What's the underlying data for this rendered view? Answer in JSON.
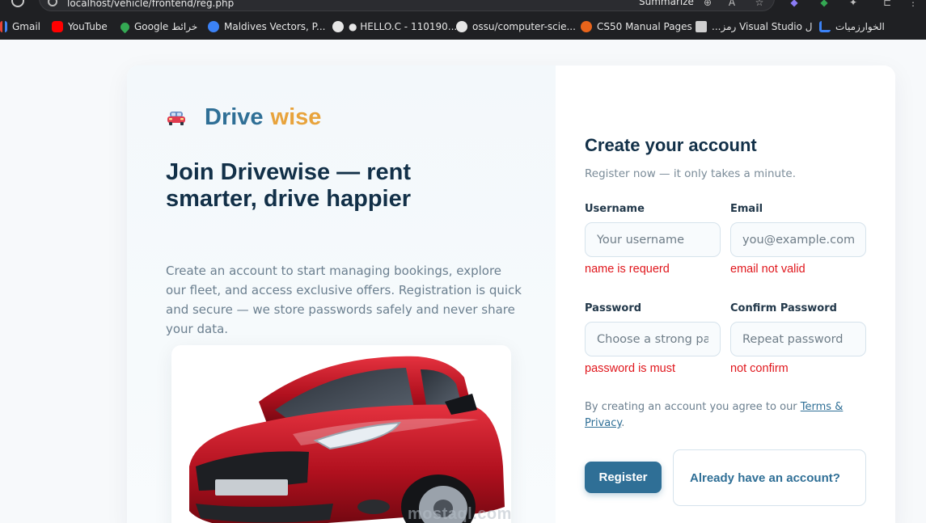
{
  "browser": {
    "url": "localhost/vehicle/frontend/reg.php",
    "summarize_label": "Summarize",
    "bookmarks": [
      {
        "label": "Gmail",
        "color": "#ea4335"
      },
      {
        "label": "YouTube",
        "color": "#ff0000"
      },
      {
        "label": "Google خرائط",
        "color": "#34a853"
      },
      {
        "label": "Maldives Vectors, P...",
        "color": "#3b82f6"
      },
      {
        "label": "● HELLO.C - 110190...",
        "color": "#e6e6e6"
      },
      {
        "label": "ossu/computer-scie...",
        "color": "#e6e6e6"
      },
      {
        "label": "CS50 Manual Pages",
        "color": "#e8641b"
      },
      {
        "label": "...رمز Visual Studio ل",
        "color": "#cfcfcf"
      },
      {
        "label": "الخوارزميات",
        "color": "#3b82f6"
      }
    ]
  },
  "brand": {
    "part1": "Drive",
    "part2": "wise"
  },
  "left": {
    "headline": "Join Drivewise — rent smarter, drive happier",
    "intro": "Create an account to start managing bookings, explore our fleet, and access exclusive offers. Registration is quick and secure — we store passwords safely and never share your data."
  },
  "form": {
    "title": "Create your account",
    "subtitle": "Register now — it only takes a minute.",
    "username": {
      "label": "Username",
      "placeholder": "Your username",
      "error": "name is requerd"
    },
    "email": {
      "label": "Email",
      "placeholder": "you@example.com",
      "error": "email not valid"
    },
    "password": {
      "label": "Password",
      "placeholder": "Choose a strong password",
      "error": "password is must"
    },
    "confirm": {
      "label": "Confirm Password",
      "placeholder": "Repeat password",
      "error": "not confirm"
    },
    "agree_text": "By creating an account you agree to our",
    "agree_link": "Terms & Privacy",
    "agree_end": ".",
    "register_label": "Register",
    "login_label": "Already have an account?"
  },
  "watermark": "mostaql.com",
  "colors": {
    "accent": "#2f6f96",
    "brand_orange": "#e8a33c",
    "error": "#e0161c",
    "heading": "#123048"
  }
}
